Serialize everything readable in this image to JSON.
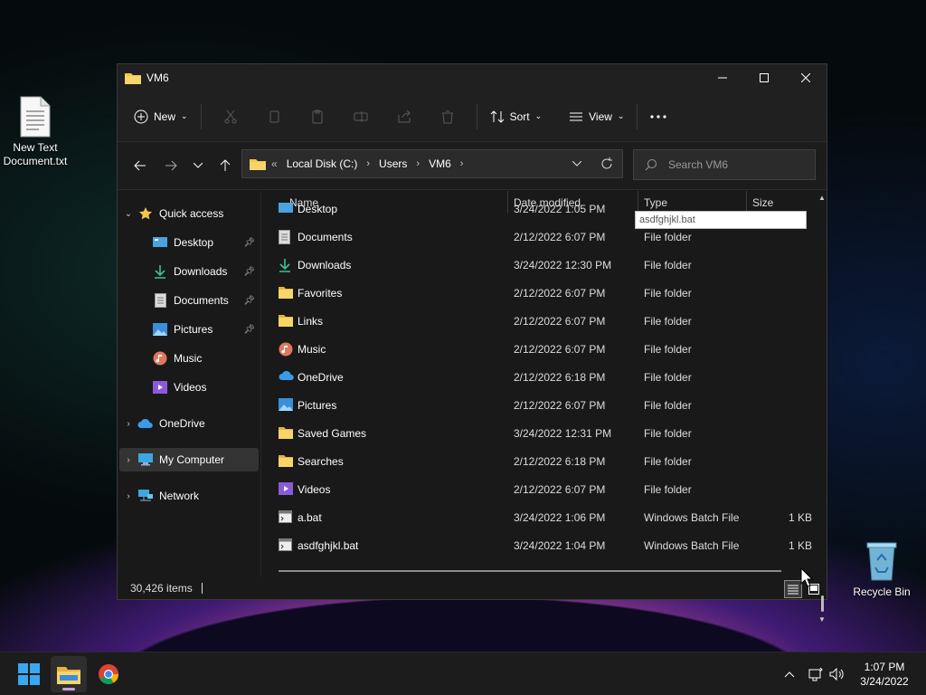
{
  "desktop": {
    "icons": [
      {
        "label": "New Text Document.txt"
      },
      {
        "label": "Recycle Bin"
      }
    ]
  },
  "window": {
    "title": "VM6",
    "toolbar": {
      "new_label": "New",
      "sort_label": "Sort",
      "view_label": "View"
    },
    "address": {
      "overflow": "«",
      "crumbs": [
        "Local Disk (C:)",
        "Users",
        "VM6"
      ]
    },
    "search_placeholder": "Search VM6",
    "nav": {
      "quick_access": "Quick access",
      "quick_items": [
        "Desktop",
        "Downloads",
        "Documents",
        "Pictures",
        "Music",
        "Videos"
      ],
      "onedrive": "OneDrive",
      "my_computer": "My Computer",
      "network": "Network"
    },
    "columns": {
      "name": "Name",
      "date": "Date modified",
      "type": "Type",
      "size": "Size"
    },
    "files": [
      {
        "name": "Desktop",
        "date": "3/24/2022 1:05 PM",
        "type": "",
        "size": "",
        "icon": "desktop-folder-icon"
      },
      {
        "name": "Documents",
        "date": "2/12/2022 6:07 PM",
        "type": "File folder",
        "size": "",
        "icon": "documents-folder-icon"
      },
      {
        "name": "Downloads",
        "date": "3/24/2022 12:30 PM",
        "type": "File folder",
        "size": "",
        "icon": "downloads-folder-icon"
      },
      {
        "name": "Favorites",
        "date": "2/12/2022 6:07 PM",
        "type": "File folder",
        "size": "",
        "icon": "folder-icon"
      },
      {
        "name": "Links",
        "date": "2/12/2022 6:07 PM",
        "type": "File folder",
        "size": "",
        "icon": "folder-icon"
      },
      {
        "name": "Music",
        "date": "2/12/2022 6:07 PM",
        "type": "File folder",
        "size": "",
        "icon": "music-folder-icon"
      },
      {
        "name": "OneDrive",
        "date": "2/12/2022 6:18 PM",
        "type": "File folder",
        "size": "",
        "icon": "onedrive-folder-icon"
      },
      {
        "name": "Pictures",
        "date": "2/12/2022 6:07 PM",
        "type": "File folder",
        "size": "",
        "icon": "pictures-folder-icon"
      },
      {
        "name": "Saved Games",
        "date": "3/24/2022 12:31 PM",
        "type": "File folder",
        "size": "",
        "icon": "folder-icon"
      },
      {
        "name": "Searches",
        "date": "2/12/2022 6:18 PM",
        "type": "File folder",
        "size": "",
        "icon": "folder-icon"
      },
      {
        "name": "Videos",
        "date": "2/12/2022 6:07 PM",
        "type": "File folder",
        "size": "",
        "icon": "videos-folder-icon"
      },
      {
        "name": "a.bat",
        "date": "3/24/2022 1:06 PM",
        "type": "Windows Batch File",
        "size": "1 KB",
        "icon": "batch-file-icon"
      },
      {
        "name": "asdfghjkl.bat",
        "date": "3/24/2022 1:04 PM",
        "type": "Windows Batch File",
        "size": "1 KB",
        "icon": "batch-file-icon"
      }
    ],
    "tooltip": "asdfghjkl.bat",
    "status": {
      "item_count": "30,426 items"
    }
  },
  "taskbar": {
    "apps": [
      {
        "icon": "start-icon"
      },
      {
        "icon": "file-explorer-icon",
        "active": true
      },
      {
        "icon": "chrome-icon"
      }
    ],
    "clock": {
      "time": "1:07 PM",
      "date": "3/24/2022"
    }
  },
  "colors": {
    "folder_yellow": "#f3c84a",
    "window_bg": "#191919",
    "taskbar_bg": "#1c1c1c",
    "accent_blue": "#3b9be8"
  }
}
